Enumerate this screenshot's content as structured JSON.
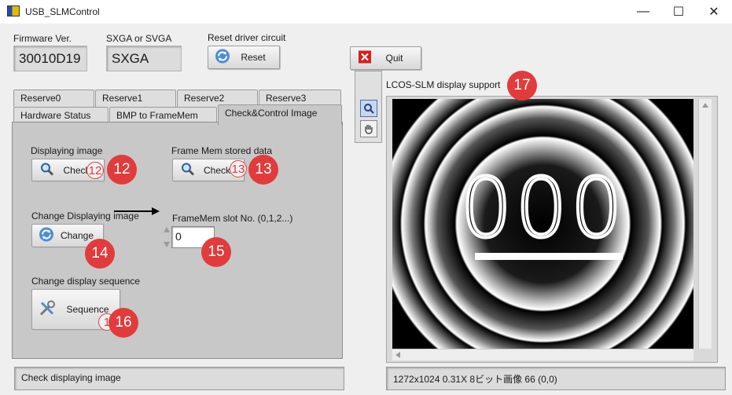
{
  "window": {
    "title": "USB_SLMControl",
    "minimize": "—",
    "maximize": "☐",
    "close": "✕"
  },
  "top": {
    "firmware_label": "Firmware Ver.",
    "firmware_value": "30010D19",
    "sxga_label": "SXGA or SVGA",
    "sxga_value": "SXGA",
    "reset_label": "Reset driver circuit",
    "reset_button": "Reset",
    "quit_button": "Quit"
  },
  "tabs": {
    "row1": [
      "Reserve0",
      "Reserve1",
      "Reserve2",
      "Reserve3"
    ],
    "row2": [
      "Hardware Status",
      "BMP to FrameMem",
      "Check&Control Image"
    ],
    "active": "Check&Control Image"
  },
  "panel": {
    "displaying_label": "Displaying image",
    "displaying_button": "Check",
    "framemem_label": "Frame Mem stored data",
    "framemem_button": "Check",
    "change_label": "Change Displaying image",
    "change_button": "Change",
    "slot_label": "FrameMem slot No. (0,1,2...)",
    "slot_value": "0",
    "sequence_label": "Change display sequence",
    "sequence_button": "Sequence"
  },
  "markers": {
    "m12": "12",
    "m13": "13",
    "m14": "14",
    "m15": "15",
    "m16": "16",
    "m17": "17",
    "s12": "12",
    "s13": "13",
    "s16": "1"
  },
  "display": {
    "label": "LCOS-SLM display support",
    "digits": "000",
    "status": "1272x1024 0.31X 8ビット画像 66   (0,0)"
  },
  "status_bar": {
    "message": "Check displaying image"
  },
  "colors": {
    "accent_red": "#e23b3b",
    "panel_bg": "#c8c8c8"
  }
}
